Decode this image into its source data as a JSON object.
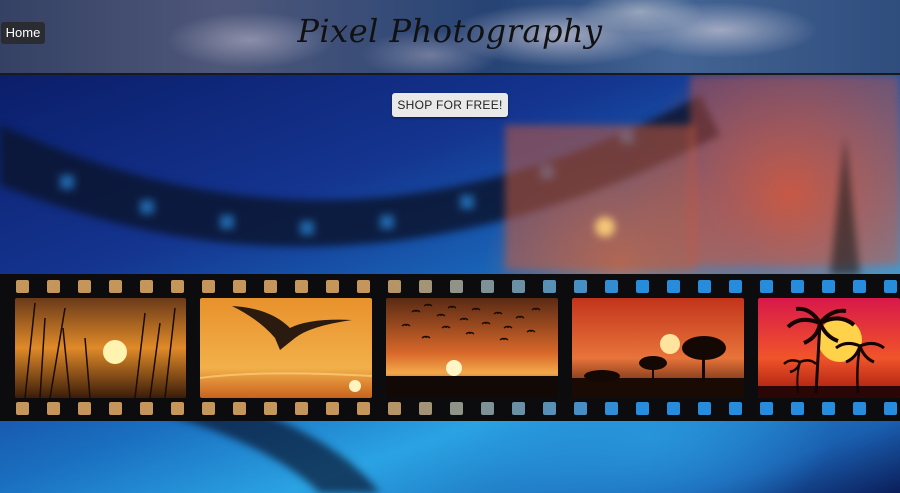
{
  "header": {
    "home_label": "Home",
    "title": "Pixel Photography"
  },
  "hero": {
    "cta_label": "SHOP FOR FREE!"
  },
  "film_strip": {
    "photos": [
      {
        "subject": "sunset-reeds"
      },
      {
        "subject": "seagull-sunset"
      },
      {
        "subject": "birds-flock-sunset"
      },
      {
        "subject": "savanna-trees-sunset"
      },
      {
        "subject": "palm-trees-sunset"
      }
    ]
  },
  "colors": {
    "hero_blue": "#1a6fc0",
    "film_black": "#0c0c0e",
    "button_bg": "#e9e9ea"
  }
}
